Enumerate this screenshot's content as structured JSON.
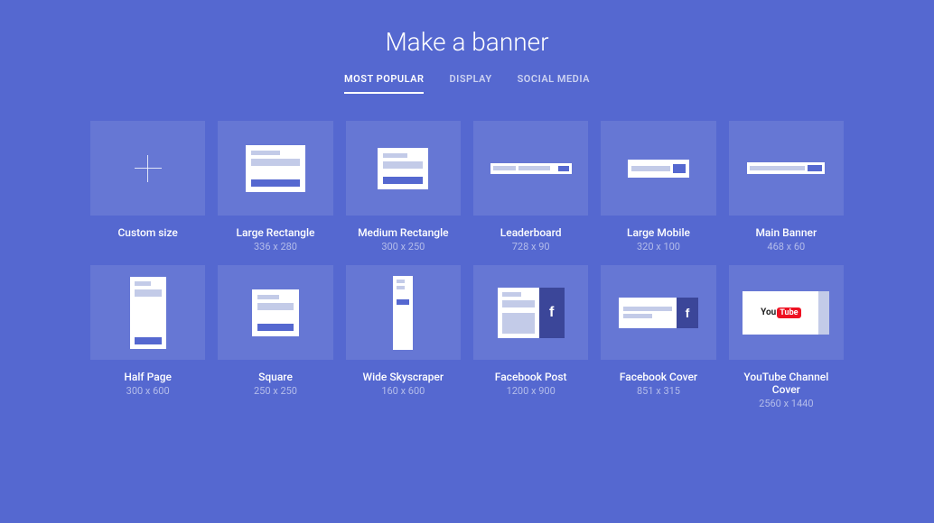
{
  "title": "Make a banner",
  "tabs": [
    {
      "label": "MOST POPULAR",
      "active": true
    },
    {
      "label": "DISPLAY",
      "active": false
    },
    {
      "label": "SOCIAL MEDIA",
      "active": false
    }
  ],
  "cards": [
    {
      "label": "Custom size",
      "dims": ""
    },
    {
      "label": "Large Rectangle",
      "dims": "336 x 280"
    },
    {
      "label": "Medium Rectangle",
      "dims": "300 x 250"
    },
    {
      "label": "Leaderboard",
      "dims": "728 x 90"
    },
    {
      "label": "Large Mobile",
      "dims": "320 x 100"
    },
    {
      "label": "Main Banner",
      "dims": "468 x 60"
    },
    {
      "label": "Half Page",
      "dims": "300 x 600"
    },
    {
      "label": "Square",
      "dims": "250 x 250"
    },
    {
      "label": "Wide Skyscraper",
      "dims": "160 x 600"
    },
    {
      "label": "Facebook Post",
      "dims": "1200 x 900"
    },
    {
      "label": "Facebook Cover",
      "dims": "851 x 315"
    },
    {
      "label": "YouTube Channel Cover",
      "dims": "2560 x 1440"
    }
  ],
  "youtube": {
    "you": "You",
    "tube": "Tube"
  },
  "social": {
    "fb_glyph": "f"
  }
}
